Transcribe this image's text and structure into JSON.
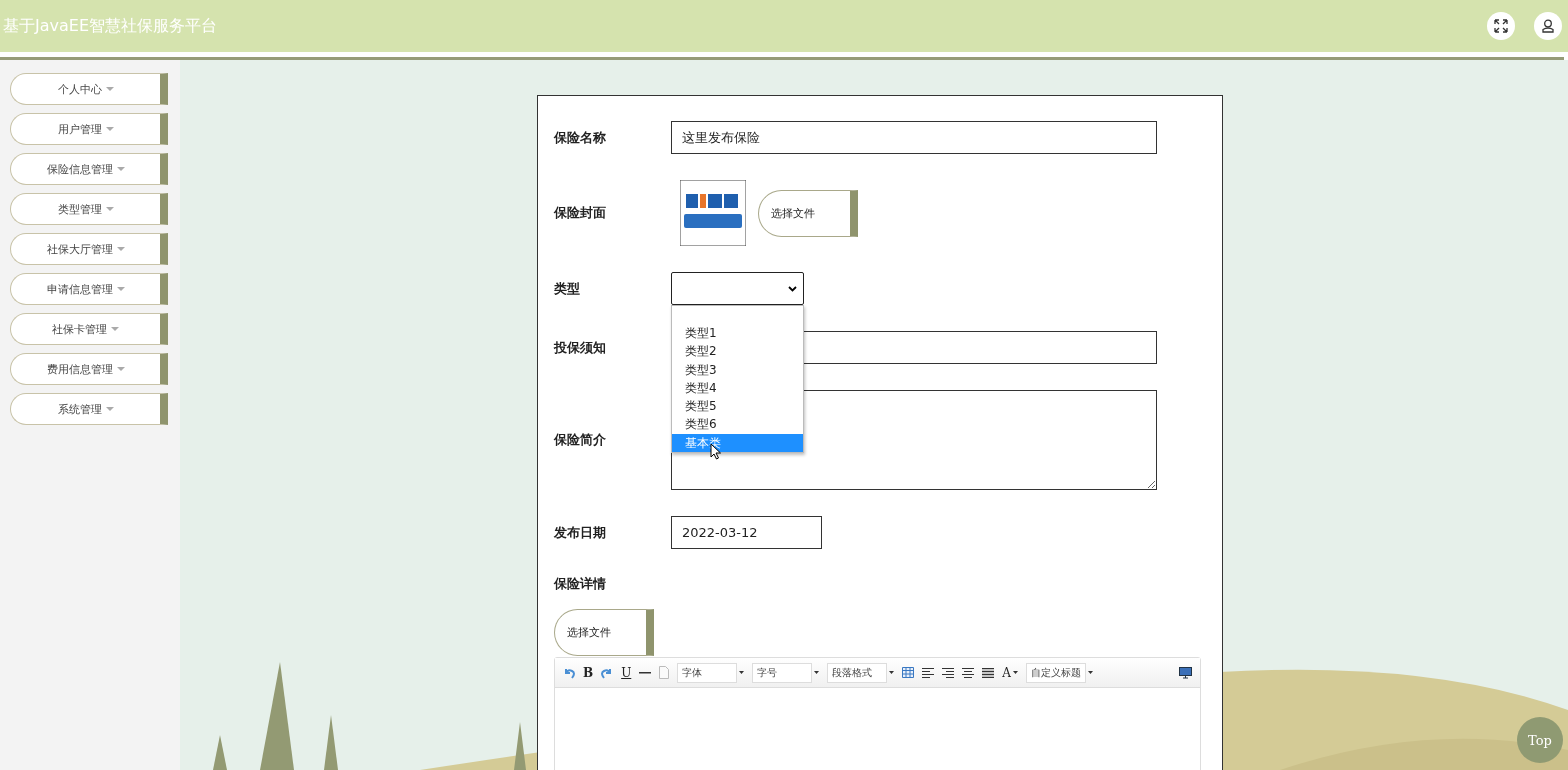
{
  "header": {
    "title": "基于JavaEE智慧社保服务平台"
  },
  "sidebar": {
    "items": [
      {
        "label": "个人中心"
      },
      {
        "label": "用户管理"
      },
      {
        "label": "保险信息管理"
      },
      {
        "label": "类型管理"
      },
      {
        "label": "社保大厅管理"
      },
      {
        "label": "申请信息管理"
      },
      {
        "label": "社保卡管理"
      },
      {
        "label": "费用信息管理"
      },
      {
        "label": "系统管理"
      }
    ]
  },
  "form": {
    "name": {
      "label": "保险名称",
      "value": "这里发布保险"
    },
    "cover": {
      "label": "保险封面",
      "button": "选择文件"
    },
    "type": {
      "label": "类型",
      "dropdown": {
        "expanded": true,
        "options": [
          {
            "label": "类型1",
            "selected": false
          },
          {
            "label": "类型2",
            "selected": false
          },
          {
            "label": "类型3",
            "selected": false
          },
          {
            "label": "类型4",
            "selected": false
          },
          {
            "label": "类型5",
            "selected": false
          },
          {
            "label": "类型6",
            "selected": false
          },
          {
            "label": "基本类",
            "selected": true
          }
        ]
      }
    },
    "notice": {
      "label": "投保须知"
    },
    "intro": {
      "label": "保险简介"
    },
    "date": {
      "label": "发布日期",
      "value": "2022-03-12"
    },
    "details": {
      "label": "保险详情",
      "button": "选择文件",
      "toolbar": [
        {
          "kind": "undo"
        },
        {
          "kind": "bold",
          "label": "B"
        },
        {
          "kind": "redo"
        },
        {
          "kind": "underline",
          "label": "U"
        },
        {
          "kind": "rule"
        },
        {
          "kind": "page"
        },
        {
          "kind": "select",
          "label": "字体"
        },
        {
          "kind": "select",
          "label": "字号"
        },
        {
          "kind": "select",
          "label": "段落格式"
        },
        {
          "kind": "table"
        },
        {
          "kind": "align-left"
        },
        {
          "kind": "align-right"
        },
        {
          "kind": "align-center"
        },
        {
          "kind": "justify"
        },
        {
          "kind": "font-color",
          "label": "A"
        },
        {
          "kind": "select",
          "label": "自定义标题"
        },
        {
          "kind": "preview"
        }
      ]
    }
  },
  "top_button": {
    "label": "Top"
  }
}
